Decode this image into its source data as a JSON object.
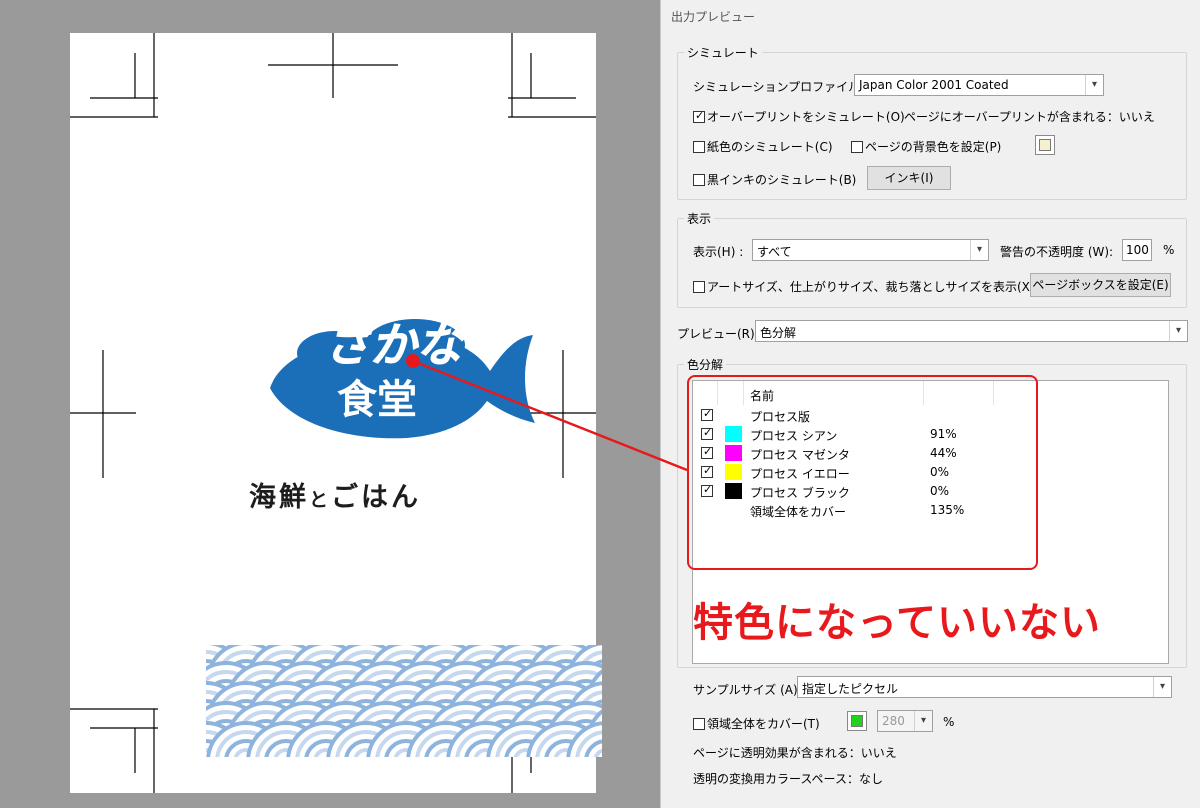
{
  "document": {
    "logo_line1": "さかな",
    "logo_line2": "食堂",
    "subtitle_part1": "海鮮",
    "subtitle_part2": "と",
    "subtitle_part3": "ごはん",
    "colors": {
      "fish": "#1a6fb8",
      "wave": "#8eb3dc",
      "wave_light": "#c5d8ef"
    }
  },
  "panel": {
    "title": "出力プレビュー",
    "simulate": {
      "legend": "シミュレート",
      "profile_label": "シミュレーションプロファイル(S) :",
      "profile_value": "Japan Color 2001 Coated",
      "overprint_label": "オーバープリントをシミュレート(O)",
      "overprint_checked": true,
      "overprint_info": "ページにオーバープリントが含まれる：いいえ",
      "paper_label": "紙色のシミュレート(C)",
      "bg_label": "ページの背景色を設定(P)",
      "bg_color": "#f5f0cf",
      "black_label": "黒インキのシミュレート(B)",
      "ink_button": "インキ(I)"
    },
    "display": {
      "legend": "表示",
      "show_label": "表示(H) :",
      "show_value": "すべて",
      "opacity_label": "警告の不透明度 (W):",
      "opacity_value": "100",
      "opacity_unit": "%",
      "boxes_label": "アートサイズ、仕上がりサイズ、裁ち落としサイズを表示(X)",
      "page_box_button": "ページボックスを設定(E)"
    },
    "preview": {
      "label": "プレビュー(R) :",
      "value": "色分解"
    },
    "separations": {
      "legend": "色分解",
      "col_name": "名前",
      "rows": [
        {
          "name": "プロセス版",
          "pct": "",
          "checked": true,
          "color": ""
        },
        {
          "name": "プロセス シアン",
          "pct": "91%",
          "checked": true,
          "color": "#00ffff"
        },
        {
          "name": "プロセス マゼンタ",
          "pct": "44%",
          "checked": true,
          "color": "#ff00ff"
        },
        {
          "name": "プロセス イエロー",
          "pct": "0%",
          "checked": true,
          "color": "#ffff00"
        },
        {
          "name": "プロセス ブラック",
          "pct": "0%",
          "checked": true,
          "color": "#000000"
        },
        {
          "name": "領域全体をカバー",
          "pct": "135%",
          "checked": false,
          "color": ""
        }
      ]
    },
    "sample": {
      "label": "サンプルサイズ (A):",
      "value": "指定したピクセル"
    },
    "coverage": {
      "label": "領域全体をカバー(T)",
      "color": "#22d31c",
      "value": "280",
      "unit": "%"
    },
    "transparency_info": "ページに透明効果が含まれる：いいえ",
    "blend_space_info": "透明の変換用カラースペース：なし"
  },
  "annotation": {
    "text": "特色になっていいない",
    "color": "#e8191c"
  }
}
